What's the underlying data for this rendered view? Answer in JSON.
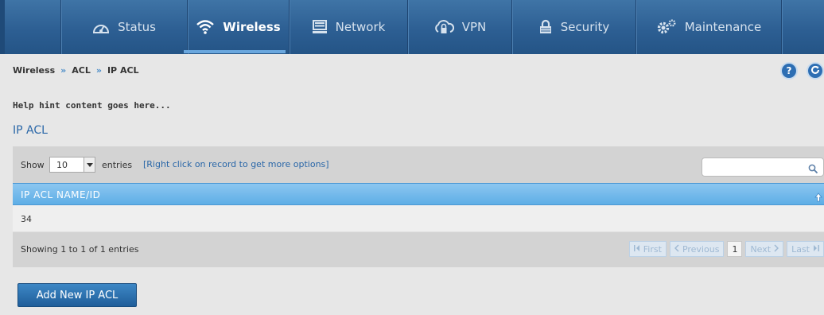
{
  "nav": {
    "items": [
      {
        "label": "Status",
        "icon": "gauge-icon"
      },
      {
        "label": "Wireless",
        "icon": "wifi-icon"
      },
      {
        "label": "Network",
        "icon": "monitor-icon"
      },
      {
        "label": "VPN",
        "icon": "cloud-lock-icon"
      },
      {
        "label": "Security",
        "icon": "lock-icon"
      },
      {
        "label": "Maintenance",
        "icon": "gears-icon"
      }
    ],
    "active": "Wireless"
  },
  "breadcrumb": {
    "items": [
      "Wireless",
      "ACL",
      "IP ACL"
    ],
    "separator": "»"
  },
  "toolbar_buttons": {
    "help_label": "?",
    "refresh_icon": "refresh-icon"
  },
  "hint": "Help hint content goes here...",
  "section_title": "IP ACL",
  "table_controls": {
    "show_label": "Show",
    "entries_value": "10",
    "entries_label": "entries",
    "hint_link": "[Right click on record to get more options]",
    "search_value": ""
  },
  "table": {
    "columns": [
      "IP ACL NAME/ID"
    ],
    "rows": [
      [
        "34"
      ]
    ]
  },
  "footer": {
    "info": "Showing 1 to 1 of 1 entries",
    "pager": {
      "first": "First",
      "previous": "Previous",
      "current": "1",
      "next": "Next",
      "last": "Last"
    }
  },
  "add_button_label": "Add New IP ACL",
  "colors": {
    "nav_bg": "#2d5f93",
    "accent": "#2a67a8",
    "table_header": "#6db6ea",
    "button": "#2a72b1"
  }
}
